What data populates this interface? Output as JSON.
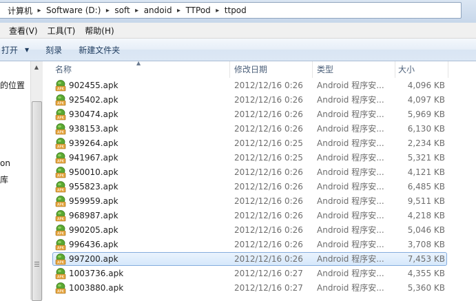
{
  "address": {
    "crumbs": [
      "计算机",
      "Software (D:)",
      "soft",
      "andoid",
      "TTPod",
      "ttpod"
    ]
  },
  "menu": [
    "查看(V)",
    "工具(T)",
    "帮助(H)"
  ],
  "toolbar": {
    "open_label": "打开",
    "burn_label": "刻录",
    "new_folder_label": "新建文件夹"
  },
  "nav": {
    "texts": [
      "的位置",
      "on",
      "库"
    ]
  },
  "columns": {
    "name": "名称",
    "date": "修改日期",
    "type": "类型",
    "size": "大小"
  },
  "files": [
    {
      "name": "902455.apk",
      "date": "2012/12/16 0:26",
      "type": "Android 程序安...",
      "size": "4,096 KB"
    },
    {
      "name": "925402.apk",
      "date": "2012/12/16 0:26",
      "type": "Android 程序安...",
      "size": "4,097 KB"
    },
    {
      "name": "930474.apk",
      "date": "2012/12/16 0:26",
      "type": "Android 程序安...",
      "size": "5,969 KB"
    },
    {
      "name": "938153.apk",
      "date": "2012/12/16 0:26",
      "type": "Android 程序安...",
      "size": "6,130 KB"
    },
    {
      "name": "939264.apk",
      "date": "2012/12/16 0:25",
      "type": "Android 程序安...",
      "size": "2,234 KB"
    },
    {
      "name": "941967.apk",
      "date": "2012/12/16 0:25",
      "type": "Android 程序安...",
      "size": "5,321 KB"
    },
    {
      "name": "950010.apk",
      "date": "2012/12/16 0:26",
      "type": "Android 程序安...",
      "size": "4,121 KB"
    },
    {
      "name": "955823.apk",
      "date": "2012/12/16 0:26",
      "type": "Android 程序安...",
      "size": "6,485 KB"
    },
    {
      "name": "959959.apk",
      "date": "2012/12/16 0:26",
      "type": "Android 程序安...",
      "size": "9,511 KB"
    },
    {
      "name": "968987.apk",
      "date": "2012/12/16 0:26",
      "type": "Android 程序安...",
      "size": "4,218 KB"
    },
    {
      "name": "990205.apk",
      "date": "2012/12/16 0:26",
      "type": "Android 程序安...",
      "size": "5,046 KB"
    },
    {
      "name": "996436.apk",
      "date": "2012/12/16 0:26",
      "type": "Android 程序安...",
      "size": "3,708 KB"
    },
    {
      "name": "997200.apk",
      "date": "2012/12/16 0:26",
      "type": "Android 程序安...",
      "size": "7,453 KB",
      "selected": true
    },
    {
      "name": "1003736.apk",
      "date": "2012/12/16 0:27",
      "type": "Android 程序安...",
      "size": "4,355 KB"
    },
    {
      "name": "1003880.apk",
      "date": "2012/12/16 0:27",
      "type": "Android 程序安...",
      "size": "5,360 KB"
    }
  ],
  "icons": {
    "file": "apk-file-icon",
    "crumb_separator": "chevron-right-icon",
    "dropdown": "chevron-down-icon",
    "sort": "sort-up-icon"
  },
  "colors": {
    "selection_fill": "#d6e8fb",
    "selection_border": "#84acdd",
    "toolbar_text": "#1e3b5e",
    "header_text": "#4c607a",
    "apk_green": "#5aa832"
  }
}
